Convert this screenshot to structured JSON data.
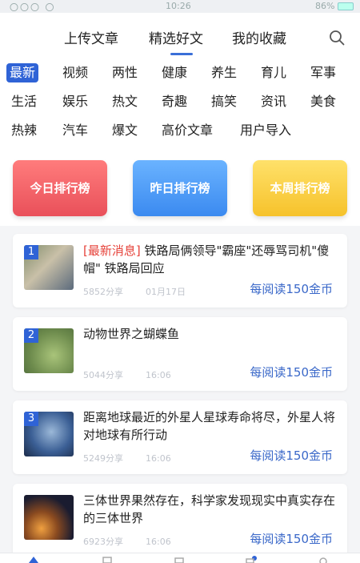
{
  "status": {
    "signal": "〇〇〇 〇",
    "time": "10:26",
    "battery": "86%"
  },
  "topnav": {
    "tabs": [
      {
        "label": "上传文章"
      },
      {
        "label": "精选好文"
      },
      {
        "label": "我的收藏"
      }
    ],
    "active_tab": 1,
    "search_icon": "search-icon"
  },
  "categories": {
    "items": [
      "最新",
      "视频",
      "两性",
      "健康",
      "养生",
      "育儿",
      "军事",
      "生活",
      "娱乐",
      "热文",
      "奇趣",
      "搞笑",
      "资讯",
      "美食",
      "热辣",
      "汽车",
      "爆文",
      "高价文章",
      "用户导入"
    ],
    "active": 0
  },
  "ranks": [
    {
      "label": "今日排行榜",
      "color": "#e9505a"
    },
    {
      "label": "昨日排行榜",
      "color": "#3b8af0"
    },
    {
      "label": "本周排行榜",
      "color": "#f6c22b"
    }
  ],
  "articles": [
    {
      "rank": "1",
      "tag": "[最新消息]",
      "title": "铁路局俩领导\"霸座\"还辱骂司机\"傻帽\" 铁路局回应",
      "shares": "5852分享",
      "time": "01月17日",
      "reward": "每阅读150金币"
    },
    {
      "rank": "2",
      "tag": "",
      "title": "动物世界之蝴蝶鱼",
      "shares": "5044分享",
      "time": "16:06",
      "reward": "每阅读150金币"
    },
    {
      "rank": "3",
      "tag": "",
      "title": "距离地球最近的外星人星球寿命将尽，外星人将对地球有所行动",
      "shares": "5249分享",
      "time": "16:06",
      "reward": "每阅读150金币"
    },
    {
      "rank": "",
      "tag": "",
      "title": "三体世界果然存在，科学家发现现实中真实存在的三体世界",
      "shares": "6923分享",
      "time": "16:06",
      "reward": "每阅读150金币"
    }
  ],
  "colors": {
    "accent": "#2f63d6",
    "tag_red": "#e6423a",
    "reward_blue": "#3a68c9"
  }
}
